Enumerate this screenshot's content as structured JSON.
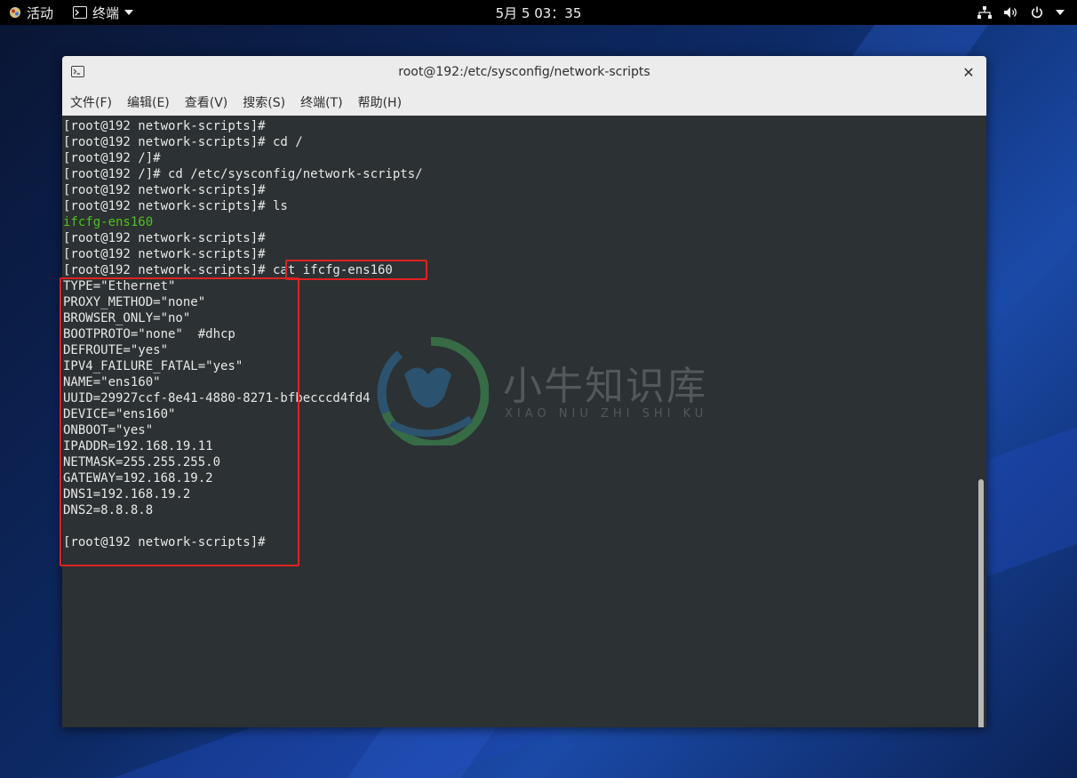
{
  "topbar": {
    "activities": "活动",
    "app_name": "终端",
    "clock": "5月 5  03：35"
  },
  "window": {
    "title": "root@192:/etc/sysconfig/network-scripts",
    "close_symbol": "✕"
  },
  "menu": [
    {
      "label": "文件(F)"
    },
    {
      "label": "编辑(E)"
    },
    {
      "label": "查看(V)"
    },
    {
      "label": "搜索(S)"
    },
    {
      "label": "终端(T)"
    },
    {
      "label": "帮助(H)"
    }
  ],
  "terminal": {
    "lines": [
      "[root@192 network-scripts]#",
      "[root@192 network-scripts]# cd /",
      "[root@192 /]#",
      "[root@192 /]# cd /etc/sysconfig/network-scripts/",
      "[root@192 network-scripts]#",
      "[root@192 network-scripts]# ls",
      "ifcfg-ens160",
      "[root@192 network-scripts]#",
      "[root@192 network-scripts]#",
      "[root@192 network-scripts]# cat ifcfg-ens160",
      "TYPE=\"Ethernet\"",
      "PROXY_METHOD=\"none\"",
      "BROWSER_ONLY=\"no\"",
      "BOOTPROTO=\"none\"  #dhcp",
      "DEFROUTE=\"yes\"",
      "IPV4_FAILURE_FATAL=\"yes\"",
      "NAME=\"ens160\"",
      "UUID=29927ccf-8e41-4880-8271-bfbecccd4fd4",
      "DEVICE=\"ens160\"",
      "ONBOOT=\"yes\"",
      "IPADDR=192.168.19.11",
      "NETMASK=255.255.255.0",
      "GATEWAY=192.168.19.2",
      "DNS1=192.168.19.2",
      "DNS2=8.8.8.8",
      "",
      "[root@192 network-scripts]#"
    ],
    "highlight_line_index": 6,
    "highlight_color": "#4ec21b",
    "text_color": "#e8e8e8",
    "background": "#2c3133"
  },
  "annotation_color": "#e0221f",
  "watermark": {
    "text": "小牛知识库",
    "subtext": "XIAO NIU ZHI SHI KU"
  },
  "icons": [
    "activities-icon",
    "terminal-icon",
    "dropdown-icon",
    "network-icon",
    "volume-icon",
    "power-icon",
    "close-icon"
  ]
}
